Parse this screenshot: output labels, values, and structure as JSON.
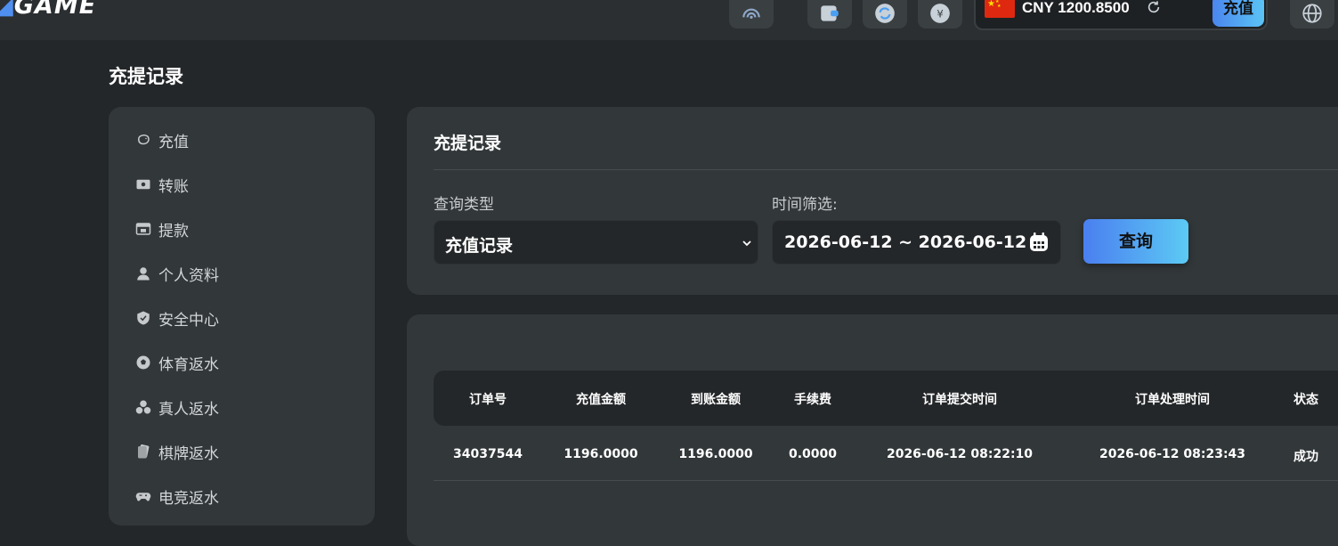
{
  "header": {
    "logo_text": "GAME",
    "balance": "CNY 1200.8500",
    "deposit_label": "充值"
  },
  "page": {
    "title": "充提记录"
  },
  "sidebar": {
    "items": [
      {
        "label": "充值",
        "icon": "piggy-bank-icon"
      },
      {
        "label": "转账",
        "icon": "money-transfer-icon"
      },
      {
        "label": "提款",
        "icon": "withdraw-icon"
      },
      {
        "label": "个人资料",
        "icon": "user-icon"
      },
      {
        "label": "安全中心",
        "icon": "shield-icon"
      },
      {
        "label": "体育返水",
        "icon": "soccer-ball-icon"
      },
      {
        "label": "真人返水",
        "icon": "chips-icon"
      },
      {
        "label": "棋牌返水",
        "icon": "cards-icon"
      },
      {
        "label": "电竞返水",
        "icon": "gamepad-icon"
      }
    ]
  },
  "filter": {
    "title": "充提记录",
    "type_label": "查询类型",
    "type_value": "充值记录",
    "time_label": "时间筛选:",
    "date_range": "2026-06-12 ~ 2026-06-12",
    "query_label": "查询"
  },
  "table": {
    "columns": [
      "订单号",
      "充值金额",
      "到账金额",
      "手续费",
      "订单提交时间",
      "订单处理时间",
      "状态"
    ],
    "rows": [
      [
        "34037544",
        "1196.0000",
        "1196.0000",
        "0.0000",
        "2026-06-12 08:22:10",
        "2026-06-12 08:23:43",
        "成功"
      ]
    ]
  },
  "colors": {
    "accent_start": "#4a86ef",
    "accent_end": "#5bc4f5",
    "background": "#242729",
    "card": "#323739"
  }
}
